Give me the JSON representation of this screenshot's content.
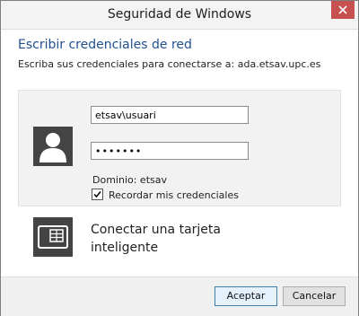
{
  "window": {
    "title": "Seguridad de Windows"
  },
  "dialog": {
    "heading": "Escribir credenciales de red",
    "subtitle": "Escriba sus credenciales para conectarse a: ada.etsav.upc.es"
  },
  "credentials": {
    "username_value": "etsav\\usuari",
    "password_value": "•••••••",
    "domain_text": "Dominio: etsav",
    "remember_label": "Recordar mis credenciales",
    "remember_checked": true
  },
  "smartcard": {
    "label": "Conectar una tarjeta inteligente"
  },
  "buttons": {
    "ok_label": "Aceptar",
    "cancel_label": "Cancelar"
  },
  "icons": {
    "close": "close-icon",
    "user": "user-avatar-icon",
    "smartcard": "smartcard-icon",
    "check": "checkmark-icon"
  },
  "colors": {
    "heading": "#1f4f8f",
    "close_bg": "#c75050",
    "tile_bg": "#444444",
    "ok_border": "#3c7fb1"
  }
}
